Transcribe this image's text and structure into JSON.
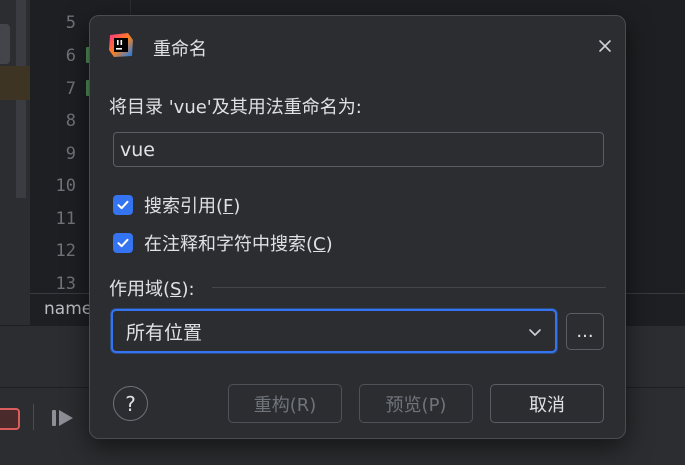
{
  "editor": {
    "line_numbers": [
      "5",
      "6",
      "7",
      "8",
      "9",
      "10",
      "11",
      "12",
      "13"
    ],
    "breadcrumb": "name"
  },
  "dialog": {
    "title": "重命名",
    "prompt": "将目录 'vue'及其用法重命名为:",
    "name_value": "vue",
    "checkboxes": [
      {
        "label_main": "搜索引用",
        "label_paren_open": "(",
        "mnemonic": "F",
        "label_paren_close": ")",
        "checked": true
      },
      {
        "label_main": "在注释和字符中搜索",
        "label_paren_open": "(",
        "mnemonic": "C",
        "label_paren_close": ")",
        "checked": true
      }
    ],
    "scope": {
      "label_main": "作用域",
      "label_paren_open": "(",
      "mnemonic": "S",
      "label_paren_close": "):",
      "selected": "所有位置",
      "more_label": "..."
    },
    "help_label": "?",
    "buttons": {
      "refactor": "重构(R)",
      "preview": "预览(P)",
      "cancel": "取消"
    }
  },
  "colors": {
    "accent": "#3574f0",
    "dialog_bg": "#2b2d30",
    "editor_bg": "#1e1f22",
    "vcs_added": "#549159"
  }
}
